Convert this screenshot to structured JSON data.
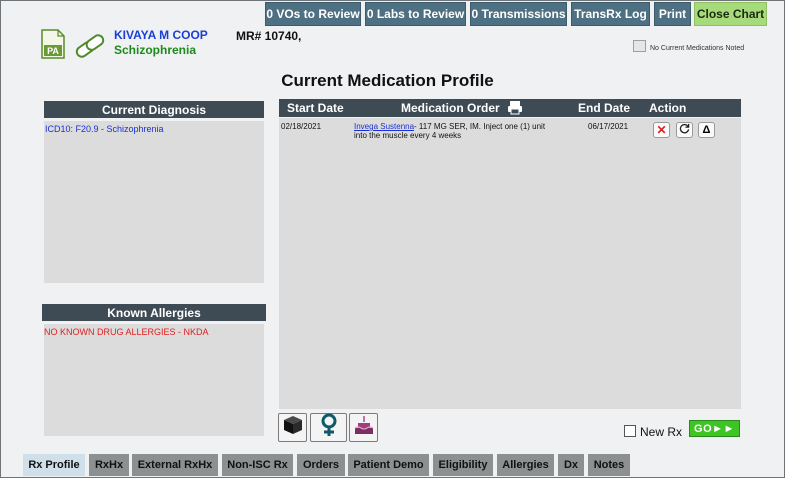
{
  "toolbar": {
    "vos": "0 VOs to Review",
    "labs": "0 Labs to Review",
    "transmissions": "0 Transmissions",
    "transrx_log": "TransRx Log",
    "print": "Print",
    "close_chart": "Close Chart"
  },
  "patient": {
    "name": "KIVAYA M COOP",
    "mr": "MR# 10740,",
    "diagnosis": "Schizophrenia"
  },
  "no_meds_label": "No Current Medications Noted",
  "page_title": "Current Medication Profile",
  "diagnosis_panel": {
    "title": "Current Diagnosis",
    "items": [
      "ICD10: F20.9 - Schizophrenia"
    ]
  },
  "allergy_panel": {
    "title": "Known Allergies",
    "items": [
      "NO KNOWN DRUG ALLERGIES - NKDA"
    ]
  },
  "med_table": {
    "headers": {
      "start": "Start Date",
      "order": "Medication Order",
      "end": "End Date",
      "action": "Action"
    },
    "rows": [
      {
        "start": "02/18/2021",
        "drug": "Invega Sustenna",
        "order_line1": "- 117 MG SER, IM. Inject one (1) unit",
        "order_line2": "into the muscle every 4 weeks",
        "end": "06/17/2021"
      }
    ]
  },
  "new_rx_label": "New Rx",
  "go_label": "GO►►",
  "tabs": [
    "Rx Profile",
    "RxHx",
    "External RxHx",
    "Non-ISC Rx",
    "Orders",
    "Patient Demo",
    "Eligibility",
    "Allergies",
    "Dx",
    "Notes"
  ]
}
